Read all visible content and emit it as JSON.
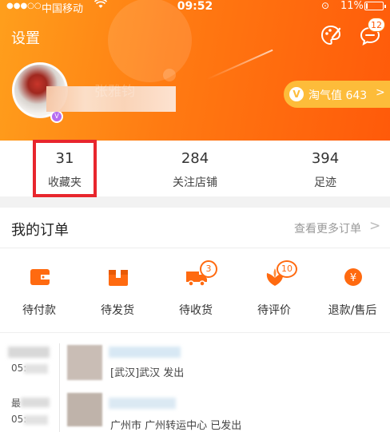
{
  "status_bar": {
    "carrier": "中国移动",
    "time": "09:52",
    "battery_percent": "11%",
    "battery_level": 0.11
  },
  "header": {
    "settings_label": "设置",
    "message_badge": "12",
    "username": "张雅钧",
    "taoqi_label": "淘气值 643",
    "taoqi_arrow": ">"
  },
  "stats": [
    {
      "value": "31",
      "label": "收藏夹"
    },
    {
      "value": "284",
      "label": "关注店铺"
    },
    {
      "value": "394",
      "label": "足迹"
    }
  ],
  "orders": {
    "title": "我的订单",
    "more_label": "查看更多订单",
    "more_arrow": ">",
    "items": [
      {
        "label": "待付款",
        "icon": "wallet-icon",
        "badge": ""
      },
      {
        "label": "待发货",
        "icon": "box-icon",
        "badge": ""
      },
      {
        "label": "待收货",
        "icon": "truck-icon",
        "badge": "3"
      },
      {
        "label": "待评价",
        "icon": "review-icon",
        "badge": "10"
      },
      {
        "label": "退款/售后",
        "icon": "refund-icon",
        "badge": ""
      }
    ]
  },
  "logistics": [
    {
      "time_prefix": "05:",
      "text": "[武汉]武汉    发出"
    },
    {
      "label_prefix": "最",
      "time_prefix": "05:",
      "text": "广州市 广州转运中心 已发出"
    }
  ],
  "colors": {
    "accent": "#ff7a12",
    "highlight": "#e8262d",
    "taoqi": "#fdbc3a"
  }
}
